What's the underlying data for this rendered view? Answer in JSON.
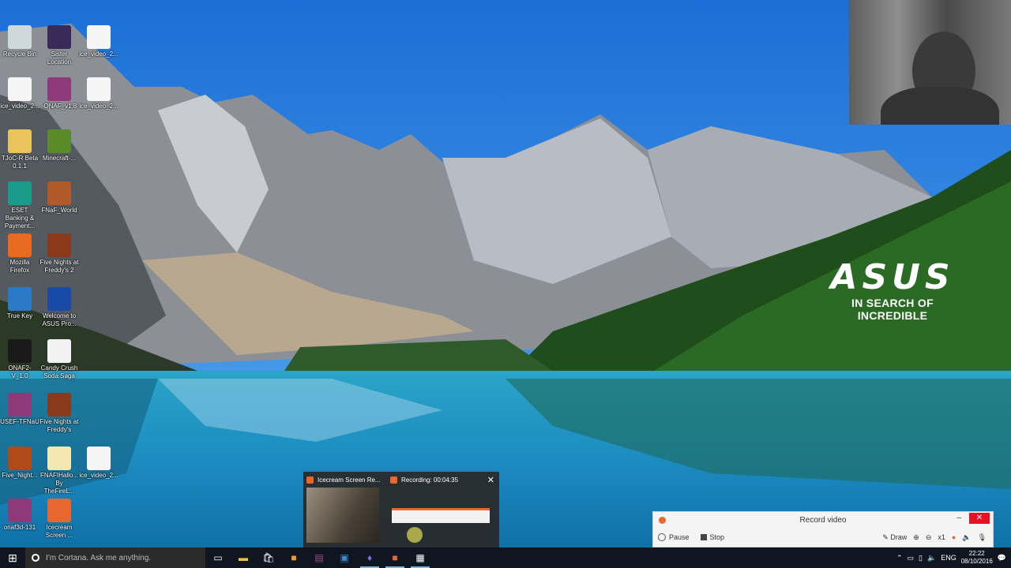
{
  "wallpaper": {
    "brand_logo": "ASUS",
    "brand_tagline": "IN SEARCH OF INCREDIBLE"
  },
  "desktop_icons": [
    {
      "label": "Recycle Bin",
      "icon": "recycle-bin-icon",
      "color": "#cfd8dc"
    },
    {
      "label": "Sister Location",
      "icon": "game-icon",
      "color": "#3a2a5a"
    },
    {
      "label": "ice_video_2...",
      "icon": "firefox-icon",
      "color": "#f5f5f5"
    },
    {
      "label": "ice_video_2...",
      "icon": "firefox-icon",
      "color": "#f5f5f5"
    },
    {
      "label": "-ONAF_v1.8",
      "icon": "archive-icon",
      "color": "#8e3a7a"
    },
    {
      "label": "ice_video_2...",
      "icon": "firefox-icon",
      "color": "#f5f5f5"
    },
    {
      "label": "TJoC-R Beta 0.1.1",
      "icon": "folder-icon",
      "color": "#e8c45a"
    },
    {
      "label": "Minecraft-...",
      "icon": "minecraft-icon",
      "color": "#5a8a2a"
    },
    {
      "label": "ESET Banking & Payment...",
      "icon": "eset-icon",
      "color": "#1a9b8a"
    },
    {
      "label": "FNaF_World",
      "icon": "freddy-icon",
      "color": "#b05a2a"
    },
    {
      "label": "Mozilla Firefox",
      "icon": "firefox-icon",
      "color": "#e86a20"
    },
    {
      "label": "Five Nights at Freddy's 2",
      "icon": "freddy-icon",
      "color": "#8a3a1a"
    },
    {
      "label": "True Key",
      "icon": "truekey-icon",
      "color": "#2a7ac8"
    },
    {
      "label": "Welcome to ASUS Pro...",
      "icon": "asus-icon",
      "color": "#1a4aa8"
    },
    {
      "label": "ONAF2-V_1.0",
      "icon": "game-icon",
      "color": "#1a1a1a"
    },
    {
      "label": "Candy Crush Soda Saga",
      "icon": "document-icon",
      "color": "#f2f2f2"
    },
    {
      "label": "USEF-TFNaU",
      "icon": "archive-icon",
      "color": "#8e3a7a"
    },
    {
      "label": "Five Nights at Freddy's",
      "icon": "freddy-icon",
      "color": "#8a3a1a"
    },
    {
      "label": "Five_Night...",
      "icon": "freddy-icon",
      "color": "#b04a1a"
    },
    {
      "label": "FNAFIHallo... By TheFireL...",
      "icon": "folder-icon",
      "color": "#f2e8b0"
    },
    {
      "label": "ice_video_2...",
      "icon": "firefox-icon",
      "color": "#f5f5f5"
    },
    {
      "label": "onaf3d-131",
      "icon": "archive-icon",
      "color": "#8e3a7a"
    },
    {
      "label": "Icecream Screen ...",
      "icon": "icecream-icon",
      "color": "#e8672c"
    }
  ],
  "taskbar": {
    "cortana_placeholder": "I'm Cortana. Ask me anything.",
    "language": "ENG",
    "time": "22:22",
    "date": "08/10/2016"
  },
  "thumbnails": [
    {
      "title": "Icecream Screen Re..."
    },
    {
      "title": "Recording: 00:04:35"
    }
  ],
  "record_panel": {
    "title": "Record video",
    "pause_label": "Pause",
    "stop_label": "Stop",
    "draw_label": "Draw",
    "zoom_label": "x1"
  }
}
